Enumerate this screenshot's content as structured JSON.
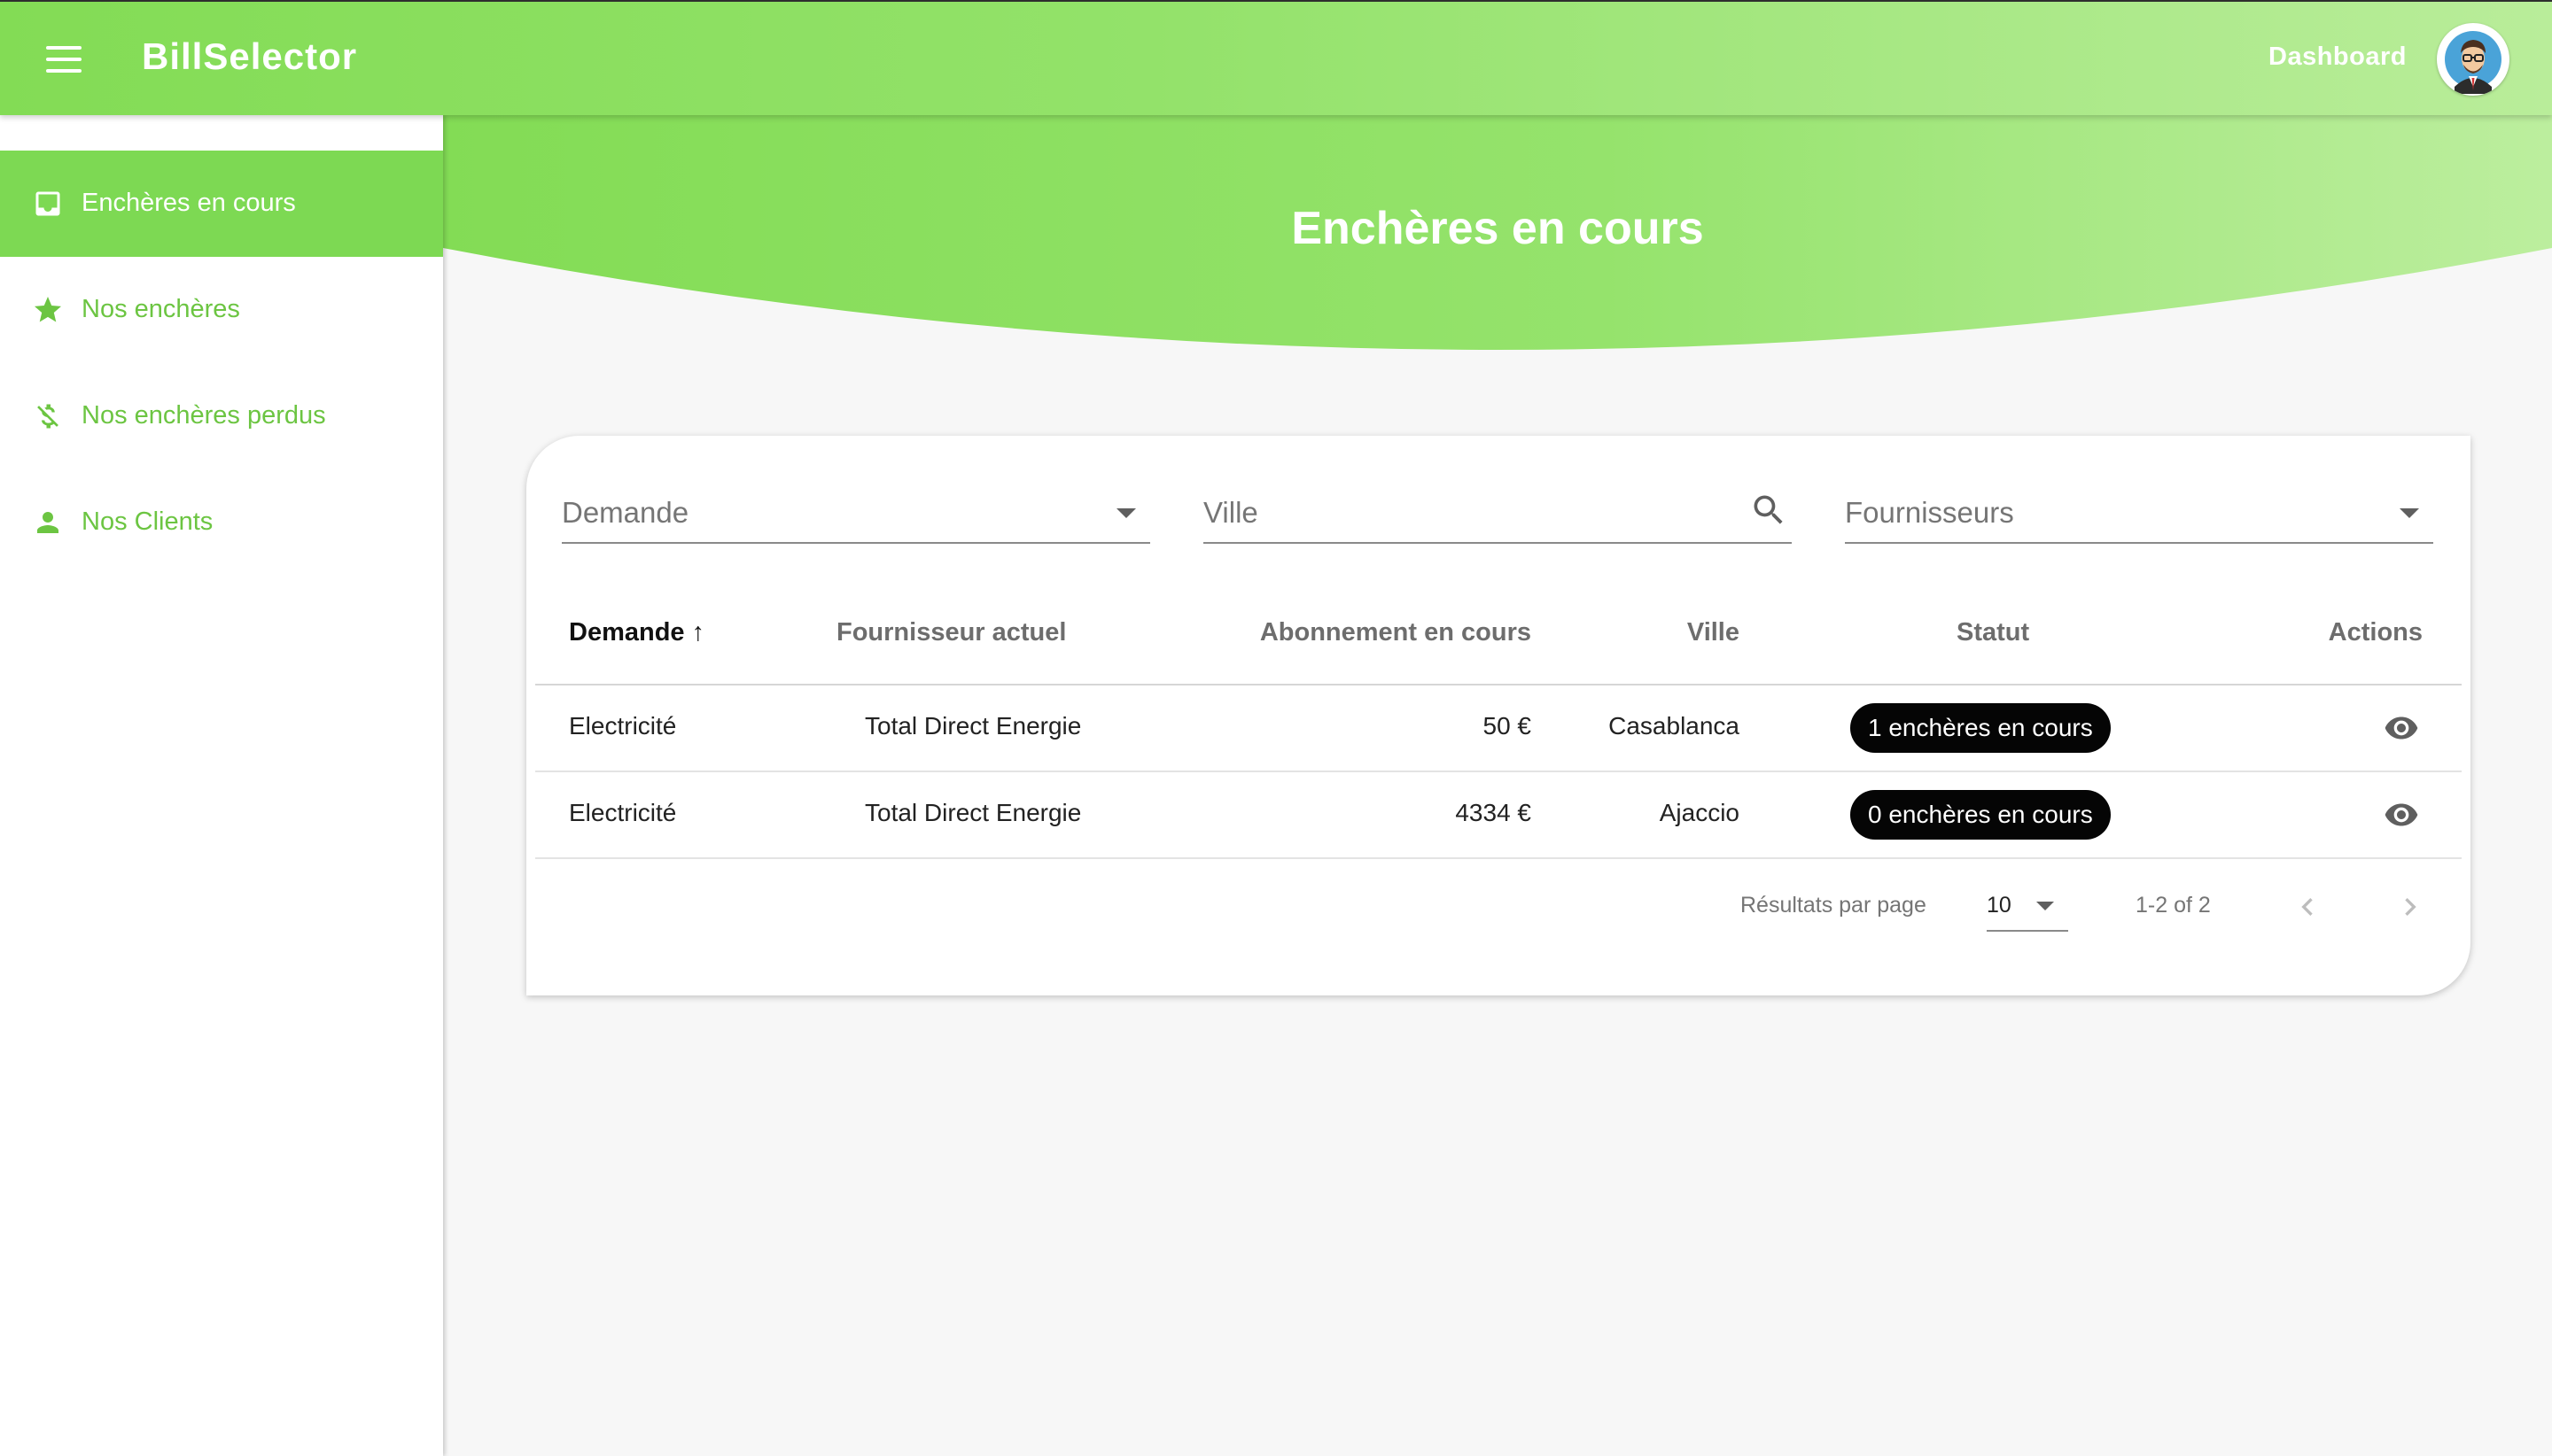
{
  "header": {
    "app_title": "BillSelector",
    "dashboard_label": "Dashboard"
  },
  "sidebar": {
    "items": [
      {
        "label": "Enchères en cours",
        "icon": "inbox-icon",
        "active": true
      },
      {
        "label": "Nos enchères",
        "icon": "star-icon",
        "active": false
      },
      {
        "label": "Nos enchères perdus",
        "icon": "money-off-icon",
        "active": false
      },
      {
        "label": "Nos Clients",
        "icon": "person-icon",
        "active": false
      }
    ]
  },
  "page": {
    "title": "Enchères en cours"
  },
  "filters": {
    "demande_placeholder": "Demande",
    "ville_placeholder": "Ville",
    "fournisseurs_placeholder": "Fournisseurs"
  },
  "table": {
    "columns": [
      "Demande",
      "Fournisseur actuel",
      "Abonnement en cours",
      "Ville",
      "Statut",
      "Actions"
    ],
    "sort_indicator": "↑",
    "rows": [
      {
        "demande": "Electricité",
        "fournisseur": "Total Direct Energie",
        "abonnement": "50 €",
        "ville": "Casablanca",
        "statut": "1 enchères en cours"
      },
      {
        "demande": "Electricité",
        "fournisseur": "Total Direct Energie",
        "abonnement": "4334 €",
        "ville": "Ajaccio",
        "statut": "0 enchères en cours"
      }
    ]
  },
  "pagination": {
    "label": "Résultats par page",
    "page_size": "10",
    "range": "1-2 of 2"
  },
  "colors": {
    "brand_green": "#83dc55",
    "active_item": "#7dd953",
    "badge": "#050505"
  }
}
